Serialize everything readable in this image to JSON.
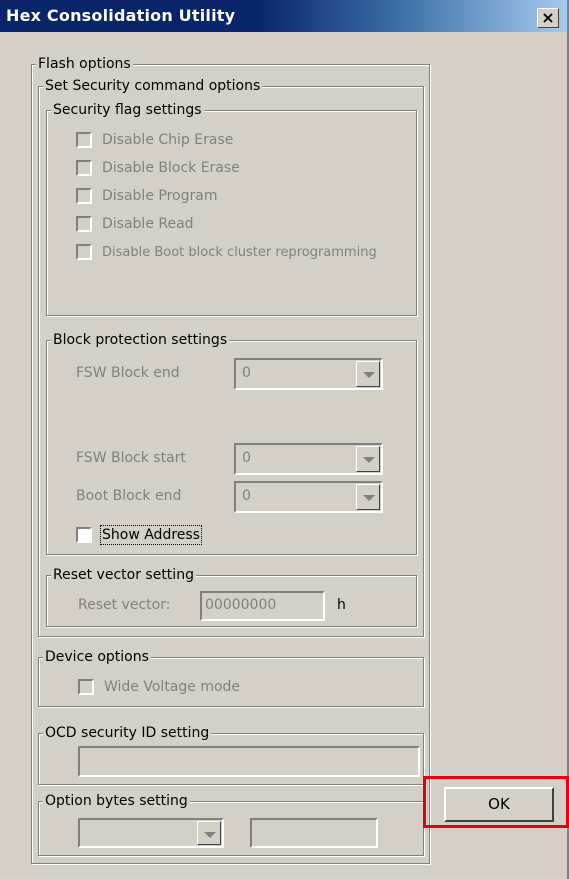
{
  "window": {
    "title": "Hex Consolidation Utility",
    "close_glyph": "×"
  },
  "flash_options": {
    "label": "Flash options",
    "set_security": {
      "label": "Set Security command options",
      "security_flags": {
        "label": "Security flag settings",
        "items": [
          {
            "label": "Disable Chip Erase",
            "checked": false,
            "enabled": false
          },
          {
            "label": "Disable Block Erase",
            "checked": false,
            "enabled": false
          },
          {
            "label": "Disable Program",
            "checked": false,
            "enabled": false
          },
          {
            "label": "Disable Read",
            "checked": false,
            "enabled": false
          },
          {
            "label": "Disable Boot block cluster reprogramming",
            "checked": false,
            "enabled": false
          }
        ]
      },
      "block_protection": {
        "label": "Block protection settings",
        "fsw_block_end": {
          "label": "FSW Block end",
          "value": "0"
        },
        "fsw_block_start": {
          "label": "FSW Block start",
          "value": "0"
        },
        "boot_block_end": {
          "label": "Boot Block end",
          "value": "0"
        },
        "show_address": {
          "label": "Show Address",
          "checked": false
        }
      },
      "reset_vector": {
        "label": "Reset vector setting",
        "field_label": "Reset vector:",
        "value": "00000000",
        "unit": "h"
      }
    },
    "device_options": {
      "label": "Device options",
      "wide_voltage": {
        "label": "Wide Voltage mode",
        "checked": false,
        "enabled": false
      }
    },
    "ocd_security": {
      "label": "OCD security ID setting",
      "value": ""
    },
    "option_bytes": {
      "label": "Option bytes setting",
      "combo_value": "",
      "text_value": ""
    }
  },
  "buttons": {
    "ok": "OK"
  },
  "colors": {
    "face": "#d4d0c8",
    "title_active": "#0a246a",
    "disabled_text": "#808080",
    "highlight_frame": "#e60012"
  }
}
